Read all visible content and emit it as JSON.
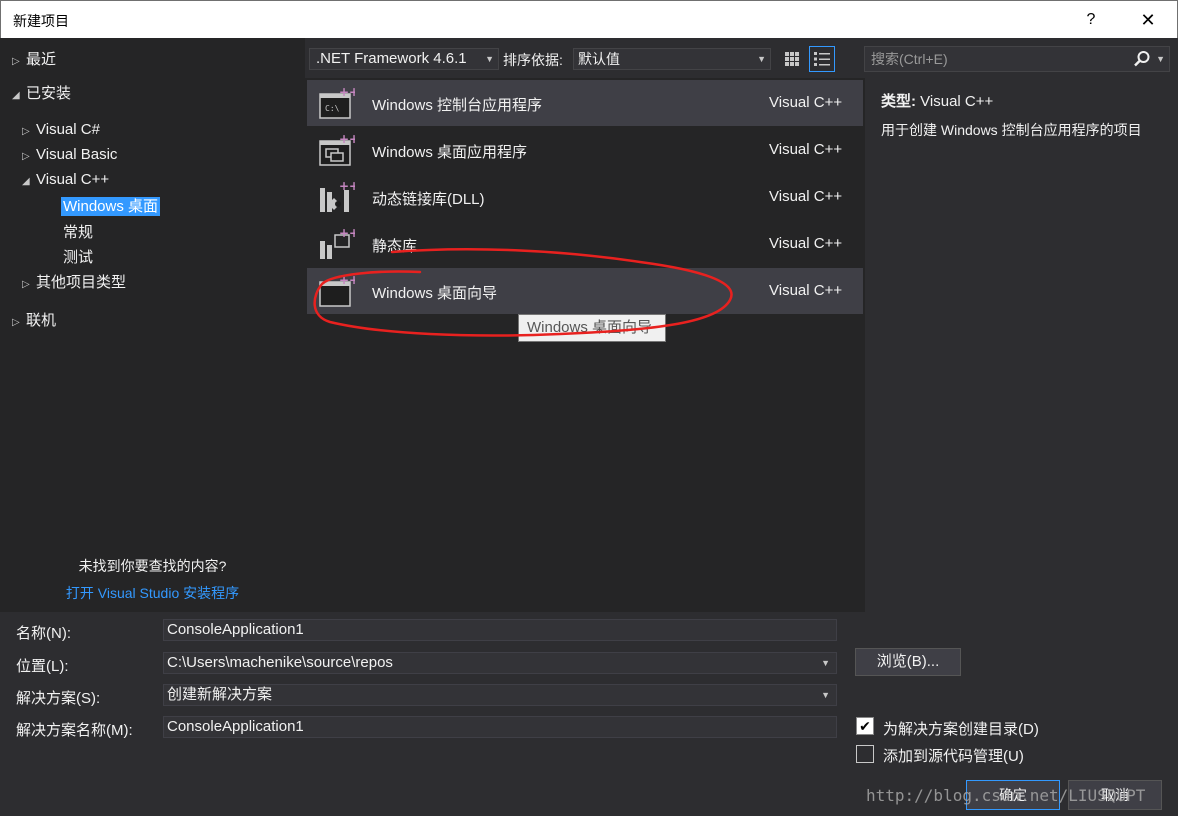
{
  "window": {
    "title": "新建项目",
    "help_label": "?",
    "close_label": "✕"
  },
  "tree": {
    "recent": "最近",
    "installed": "已安装",
    "visual_csharp": "Visual C#",
    "visual_basic": "Visual Basic",
    "visual_cpp": "Visual C++",
    "windows_desktop": "Windows 桌面",
    "general": "常规",
    "test": "测试",
    "other_types": "其他项目类型",
    "online": "联机",
    "not_found": "未找到你要查找的内容?",
    "open_installer": "打开 Visual Studio 安装程序"
  },
  "toolbar": {
    "framework": ".NET Framework 4.6.1",
    "sort_label": "排序依据:",
    "sort_value": "默认值",
    "search_placeholder": "搜索(Ctrl+E)"
  },
  "templates": [
    {
      "name": "Windows 控制台应用程序",
      "lang": "Visual C++",
      "icon": "console-app-icon"
    },
    {
      "name": "Windows 桌面应用程序",
      "lang": "Visual C++",
      "icon": "desktop-app-icon"
    },
    {
      "name": "动态链接库(DLL)",
      "lang": "Visual C++",
      "icon": "dll-icon"
    },
    {
      "name": "静态库",
      "lang": "Visual C++",
      "icon": "static-lib-icon"
    },
    {
      "name": "Windows 桌面向导",
      "lang": "Visual C++",
      "icon": "desktop-wizard-icon"
    }
  ],
  "tooltip": "Windows 桌面向导",
  "description": {
    "type_label": "类型:",
    "type_value": "Visual C++",
    "text": "用于创建 Windows 控制台应用程序的项目"
  },
  "form": {
    "name_label": "名称(N):",
    "name_value": "ConsoleApplication1",
    "location_label": "位置(L):",
    "location_value": "C:\\Users\\machenike\\source\\repos",
    "solution_label": "解决方案(S):",
    "solution_value": "创建新解决方案",
    "solution_name_label": "解决方案名称(M):",
    "solution_name_value": "ConsoleApplication1",
    "browse_label": "浏览(B)...",
    "create_dir_label": "为解决方案创建目录(D)",
    "create_dir_checked": true,
    "source_control_label": "添加到源代码管理(U)",
    "source_control_checked": false,
    "ok_label": "确定",
    "cancel_label": "取消"
  },
  "watermark": "http://blog.csdn.net/LIUSQUPT",
  "colors": {
    "accent": "#3399ff",
    "annotation": "#e8211f",
    "icon_plus": "#c586c0"
  }
}
